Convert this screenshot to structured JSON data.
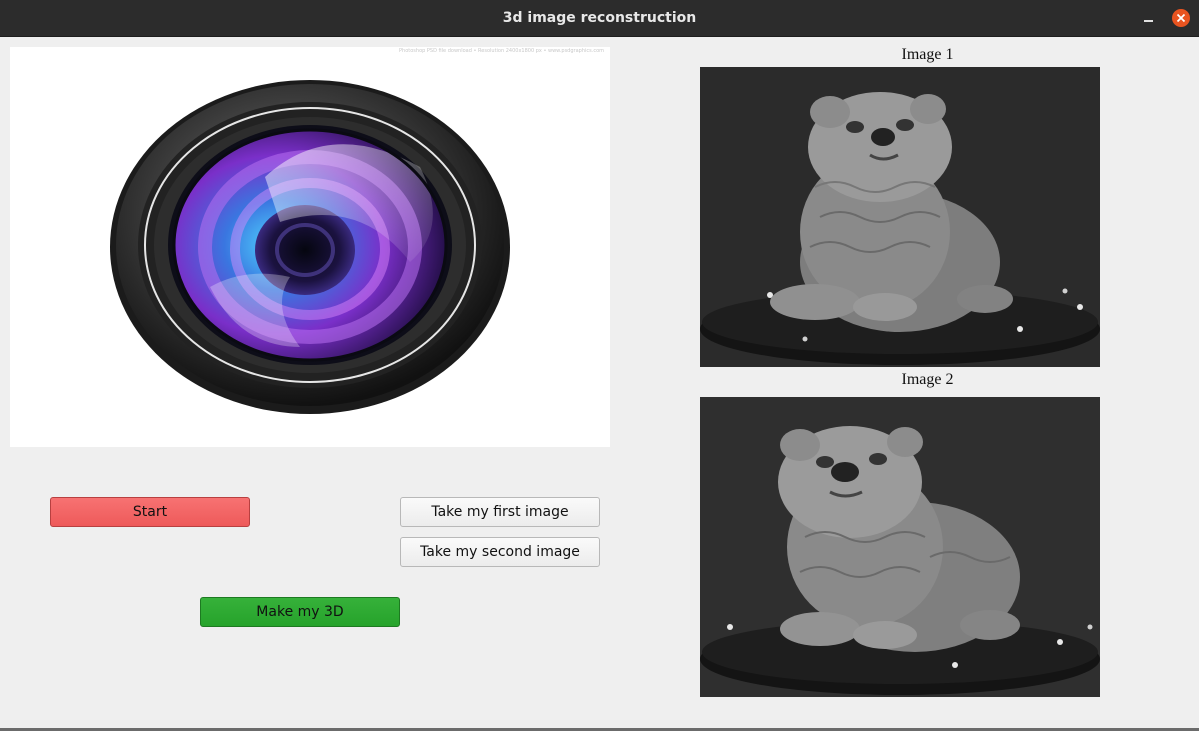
{
  "window": {
    "title": "3d image reconstruction",
    "controls": {
      "minimize_icon": "minimize-icon",
      "close_icon": "close-icon"
    }
  },
  "preview": {
    "image": "camera-lens",
    "watermark": "Photoshop PSD file download  •  Resolution 2400x1800 px  •  www.psdgraphics.com"
  },
  "buttons": {
    "start": "Start",
    "take_first": "Take my first image",
    "take_second": "Take my second image",
    "make_3d": "Make my 3D"
  },
  "images": [
    {
      "caption": "Image 1",
      "content": "grayscale photo of a dog statue on a turntable"
    },
    {
      "caption": "Image 2",
      "content": "grayscale photo of a dog statue on a turntable"
    }
  ],
  "colors": {
    "start_button": "#ee5a5a",
    "make3d_button": "#26a32b",
    "close_button": "#e95420",
    "titlebar": "#2c2c2c"
  }
}
